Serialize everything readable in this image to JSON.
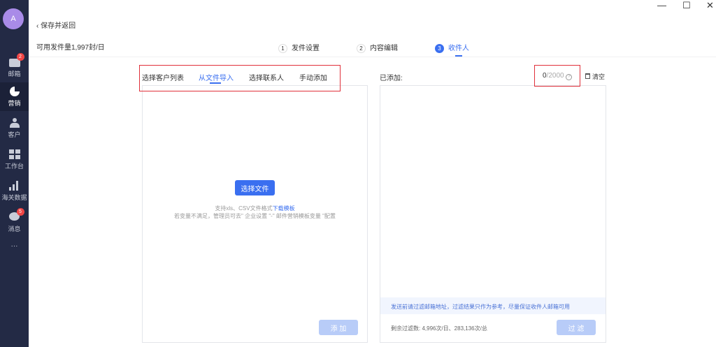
{
  "sidebar": {
    "avatar": "A",
    "items": [
      {
        "label": "邮箱",
        "icon": "mail-icon",
        "badge": "2"
      },
      {
        "label": "营销",
        "icon": "pie-chart-icon",
        "active": true
      },
      {
        "label": "客户",
        "icon": "user-icon"
      },
      {
        "label": "工作台",
        "icon": "dashboard-icon"
      },
      {
        "label": "海关数据",
        "icon": "bar-chart-icon"
      },
      {
        "label": "消息",
        "icon": "chat-icon",
        "badge": "5"
      }
    ],
    "more": "···"
  },
  "window": {
    "minimize": "—",
    "maximize": "☐",
    "close": "✕"
  },
  "header": {
    "back": "保存并返回",
    "quota": "可用发件量1,997封/日"
  },
  "steps": [
    {
      "num": "1",
      "label": "发件设置"
    },
    {
      "num": "2",
      "label": "内容编辑"
    },
    {
      "num": "3",
      "label": "收件人",
      "active": true
    }
  ],
  "tabs": [
    "选择客户列表",
    "从文件导入",
    "选择联系人",
    "手动添加"
  ],
  "left": {
    "choose_file": "选择文件",
    "hint1": "支持xls、CSV文件格式",
    "download": "下载模板",
    "hint2": "若变量不满足，管理员可去\" 企业设置 \"-\" 邮件营销模板变量 \"配置",
    "add": "添 加"
  },
  "right": {
    "added_label": "已添加:",
    "count": "0",
    "max": "/2000",
    "clear": "清空",
    "notice": "发送前请过滤邮箱地址，过滤结果只作为参考，尽量保证收件人邮箱可用",
    "remaining": "剩余过滤数: 4,996次/日、283,136次/总",
    "filter": "过 滤"
  },
  "colors": {
    "accent": "#3a6ff0",
    "sidebar": "#232a45",
    "badge": "#f04545",
    "annotation": "#e0303a"
  }
}
